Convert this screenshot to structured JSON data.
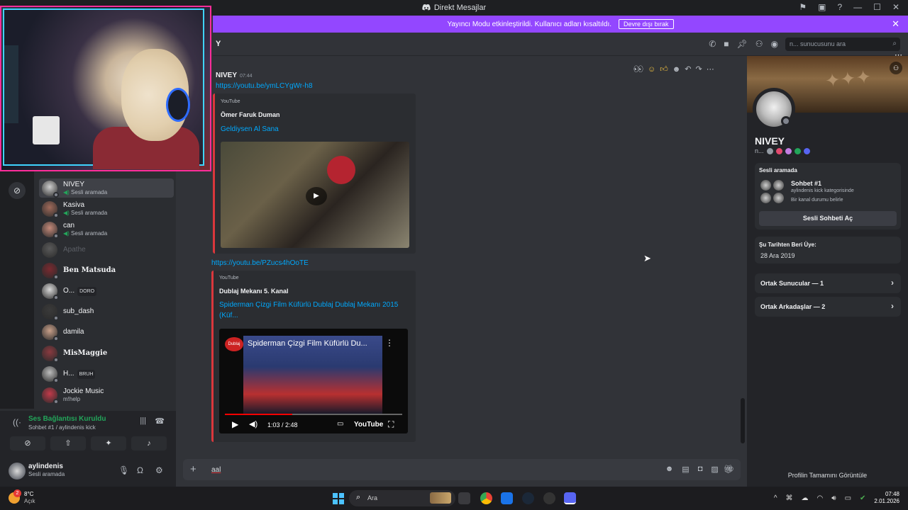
{
  "titlebar": {
    "title": "Direkt Mesajlar"
  },
  "banner": {
    "text": "Yayıncı Modu etkinleştirildi. Kullanıcı adları kısaltıldı.",
    "button": "Devre dışı bırak"
  },
  "header": {
    "name": "Y",
    "search_placeholder": "n... sunucusunu ara"
  },
  "members": [
    {
      "name": "NIVEY",
      "status": "Sesli aramada",
      "active": true
    },
    {
      "name": "Kasiva",
      "status": "Sesli aramada"
    },
    {
      "name": "can",
      "status": "Sesli aramada"
    },
    {
      "name": "Apathe",
      "status": "",
      "dim": true
    },
    {
      "name": "Ben Matsuda",
      "status": "",
      "fancy": true
    },
    {
      "name": "O...",
      "status": "",
      "tag": "DORO"
    },
    {
      "name": "sub_dash",
      "status": ""
    },
    {
      "name": "damila",
      "status": ""
    },
    {
      "name": "MisMaggie",
      "status": "",
      "fancy": true
    },
    {
      "name": "H...",
      "status": "",
      "tag": "BRUH"
    },
    {
      "name": "Jockie Music",
      "status": "m!help"
    }
  ],
  "voice": {
    "title": "Ses Bağlantısı Kuruldu",
    "subtitle": "Sohbet #1 / aylindenis kick"
  },
  "user": {
    "name": "aylindenis",
    "status": "Sesli aramada"
  },
  "messages": {
    "author": "NIVEY",
    "time": "07:44",
    "link1": "https://youtu.be/ymLCYgWr-h8",
    "embed1": {
      "provider": "YouTube",
      "author": "Ömer Faruk Duman",
      "title": "Geldiysen Al Sana"
    },
    "link2": "https://youtu.be/PZucs4hOoTE",
    "embed2": {
      "provider": "YouTube",
      "author": "Dublaj Mekanı 5. Kanal",
      "title": "Spiderman Çizgi Film Küfürlü Dublaj   Dublaj Mekanı 2015 (Küf...",
      "video_title": "Spiderman Çizgi Film Küfürlü Du...",
      "channel_logo_text": "Dublaj Mekanı",
      "time": "1:03 / 2:48",
      "progress": 0.38,
      "yt_label": "YouTube"
    }
  },
  "input": {
    "value": "aal"
  },
  "profile": {
    "name": "NIVEY",
    "short": "n...",
    "voice_label": "Sesli aramada",
    "channel": "Sohbet #1",
    "category": "aylindenis kick kategorisinde",
    "channel_status": "Bir kanal durumu belirle",
    "open_button": "Sesli Sohbeti Aç",
    "member_since_label": "Şu Tarihten Beri Üye:",
    "member_since": "28 Ara 2019",
    "mutual_servers": "Ortak Sunucular — 1",
    "mutual_friends": "Ortak Arkadaşlar — 2",
    "full_profile": "Profilin Tamamını Görüntüle"
  },
  "taskbar": {
    "temp": "8°C",
    "weather": "Açık",
    "badge": "2",
    "search": "Ara",
    "time": "07:48",
    "date": "2.01.2026"
  },
  "colors": {
    "accent": "#9347ff",
    "link": "#00a8fc",
    "online_green": "#23a55a",
    "embed_border": "#da373c",
    "webcam_border": "#ff2d9a"
  }
}
